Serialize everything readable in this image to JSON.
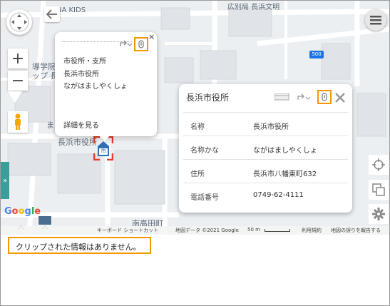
{
  "map": {
    "labels": {
      "kids": "NA KIDS",
      "top_partial": "広別局 長浜文明",
      "school_1": "導学院",
      "school_2": "ップ 長",
      "ma": "ま",
      "city_hall_label": "長浜市役所",
      "minami": "南高田町",
      "road_number": "500"
    },
    "marker_label": "市",
    "google_logo": "Google",
    "footer": {
      "shortcuts": "キーボード ショートカット",
      "copyright": "地図データ ©2021 Google",
      "scale": "50 m",
      "terms": "利用規約",
      "report": "地図の誤りを報告する"
    }
  },
  "popup": {
    "category": "市役所・支所",
    "name": "長浜市役所",
    "kana": "ながはましやくしょ",
    "details_link": "詳細を見る",
    "close": "×"
  },
  "card": {
    "title": "長浜市役所",
    "rows": [
      {
        "key": "名称",
        "value": "長浜市役所"
      },
      {
        "key": "名称かな",
        "value": "ながはましやくしょ"
      },
      {
        "key": "住所",
        "value": "長浜市八幡東町632"
      },
      {
        "key": "電話番号",
        "value": "0749-62-4111"
      }
    ]
  },
  "controls": {
    "zoom_in": "+",
    "zoom_out": "−",
    "side_tab": "»",
    "menu_icon": "menu-icon"
  },
  "clip_message": "クリップされた情報はありません。",
  "colors": {
    "accent": "#f39800",
    "marker": "#e8392b",
    "marker_icon": "#2f6fb3",
    "side_tab": "#3a9e9a"
  }
}
